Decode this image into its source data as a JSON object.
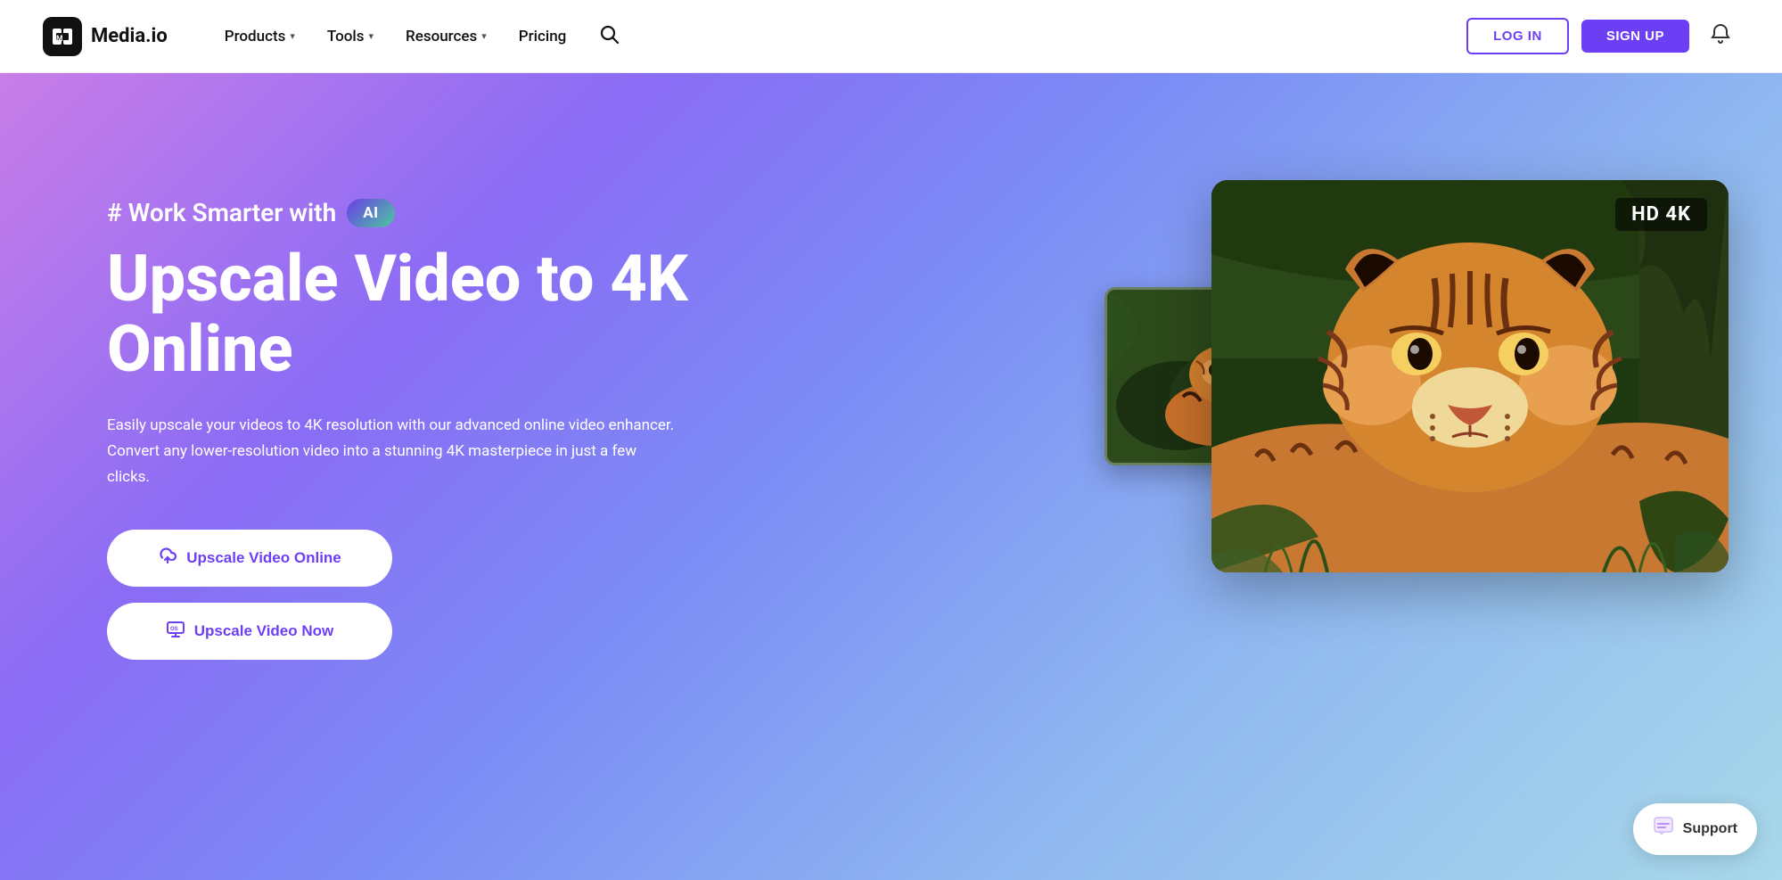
{
  "navbar": {
    "logo_text": "Media.io",
    "logo_abbr": "M",
    "nav_products": "Products",
    "nav_tools": "Tools",
    "nav_resources": "Resources",
    "nav_pricing": "Pricing",
    "btn_login": "LOG IN",
    "btn_signup": "SIGN UP"
  },
  "hero": {
    "subtitle": "# Work Smarter with",
    "ai_badge": "AI",
    "title_line1": "Upscale Video to 4K",
    "title_line2": "Online",
    "description_line1": "Easily upscale your videos to 4K resolution with our advanced online video enhancer.",
    "description_line2": "Convert any lower-resolution video into a stunning 4K masterpiece in just a few clicks.",
    "btn_upscale_online": "Upscale Video Online",
    "btn_upscale_now": "Upscale Video Now",
    "hd4k_label": "HD 4K"
  },
  "support": {
    "label": "Support"
  },
  "colors": {
    "purple": "#6c3ff5",
    "hero_gradient_start": "#c97de8",
    "hero_gradient_end": "#a8d8ea"
  }
}
